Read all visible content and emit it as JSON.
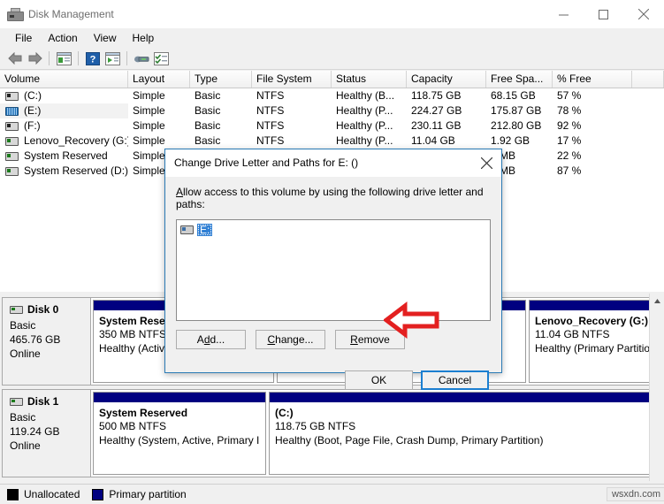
{
  "window": {
    "title": "Disk Management",
    "icon": "disk-management-icon",
    "minimize": "─",
    "maximize": "□",
    "close": "✕"
  },
  "menu": {
    "items": [
      "File",
      "Action",
      "View",
      "Help"
    ]
  },
  "toolbar": {
    "buttons": [
      {
        "name": "back-icon",
        "glyph": "←"
      },
      {
        "name": "forward-icon",
        "glyph": "→"
      },
      {
        "name": "show-hide-console-tree-icon",
        "glyph": "▤"
      },
      {
        "name": "help-icon",
        "glyph": "?"
      },
      {
        "name": "show-hide-action-pane-icon",
        "glyph": "▶"
      },
      {
        "name": "rescan-disks-icon",
        "glyph": "⚭"
      },
      {
        "name": "properties-icon",
        "glyph": "☑"
      }
    ]
  },
  "volume_table": {
    "columns": [
      "Volume",
      "Layout",
      "Type",
      "File System",
      "Status",
      "Capacity",
      "Free Spa...",
      "% Free"
    ],
    "rows": [
      {
        "icon": "drive-icon-dark",
        "volume": "(C:)",
        "layout": "Simple",
        "type": "Basic",
        "fs": "NTFS",
        "status": "Healthy (B...",
        "capacity": "118.75 GB",
        "free": "68.15 GB",
        "pct": "57 %",
        "selected": false
      },
      {
        "icon": "drive-icon-striped",
        "volume": "(E:)",
        "layout": "Simple",
        "type": "Basic",
        "fs": "NTFS",
        "status": "Healthy (P...",
        "capacity": "224.27 GB",
        "free": "175.87 GB",
        "pct": "78 %",
        "selected": true
      },
      {
        "icon": "drive-icon-dark",
        "volume": "(F:)",
        "layout": "Simple",
        "type": "Basic",
        "fs": "NTFS",
        "status": "Healthy (P...",
        "capacity": "230.11 GB",
        "free": "212.80 GB",
        "pct": "92 %",
        "selected": false
      },
      {
        "icon": "drive-icon-green",
        "volume": "Lenovo_Recovery (G:)",
        "layout": "Simple",
        "type": "Basic",
        "fs": "NTFS",
        "status": "Healthy (P...",
        "capacity": "11.04 GB",
        "free": "1.92 GB",
        "pct": "17 %",
        "selected": false
      },
      {
        "icon": "drive-icon-green",
        "volume": "System Reserved",
        "layout": "Simple",
        "type": "",
        "fs": "",
        "status": "",
        "capacity": "",
        "free": "0 MB",
        "pct": "22 %",
        "selected": false
      },
      {
        "icon": "drive-icon-green",
        "volume": "System Reserved (D:)",
        "layout": "Simple",
        "type": "",
        "fs": "",
        "status": "",
        "capacity": "",
        "free": "5 MB",
        "pct": "87 %",
        "selected": false
      }
    ]
  },
  "disks": [
    {
      "name": "Disk 0",
      "type": "Basic",
      "size": "465.76 GB",
      "state": "Online",
      "partitions": [
        {
          "name": "System Rese",
          "line1": "350 MB NTFS",
          "line2": "Healthy (Activ",
          "flex": "0 0 205px"
        },
        {
          "name": "",
          "line1": "",
          "line2": "",
          "flex": "1 1 auto"
        },
        {
          "name": "Lenovo_Recovery  (G:)",
          "line1": "11.04 GB NTFS",
          "line2": "Healthy (Primary Partitior",
          "flex": "0 0 150px"
        }
      ]
    },
    {
      "name": "Disk 1",
      "type": "Basic",
      "size": "119.24 GB",
      "state": "Online",
      "partitions": [
        {
          "name": "System Reserved",
          "line1": "500 MB NTFS",
          "line2": "Healthy (System, Active, Primary I",
          "flex": "0 0 196px"
        },
        {
          "name": "(C:)",
          "line1": "118.75 GB NTFS",
          "line2": "Healthy (Boot, Page File, Crash Dump, Primary Partition)",
          "flex": "1 1 auto"
        }
      ]
    }
  ],
  "legend": {
    "items": [
      {
        "label": "Unallocated",
        "color": "#000000"
      },
      {
        "label": "Primary partition",
        "color": "#000080"
      }
    ]
  },
  "watermark": "wsxdn.com",
  "dialog": {
    "title": "Change Drive Letter and Paths for E: ()",
    "close_glyph": "✕",
    "label_prefix": "A",
    "label_rest": "llow access to this volume by using the following drive letter and paths:",
    "list_items": [
      {
        "icon": "drive-icon",
        "text": "E:"
      }
    ],
    "buttons": {
      "add": {
        "pre": "A",
        "mid": "d",
        "post": "d..."
      },
      "change": {
        "pre": "",
        "mid": "C",
        "post": "hange..."
      },
      "remove": {
        "pre": "",
        "mid": "R",
        "post": "emove"
      },
      "ok": "OK",
      "cancel": "Cancel"
    }
  },
  "annotation": {
    "arrow": "red-left-arrow",
    "color": "#e32020"
  },
  "colors": {
    "partition_bar": "#000080",
    "selection": "#2f7fd4",
    "dialog_border": "#2a7ab5"
  }
}
